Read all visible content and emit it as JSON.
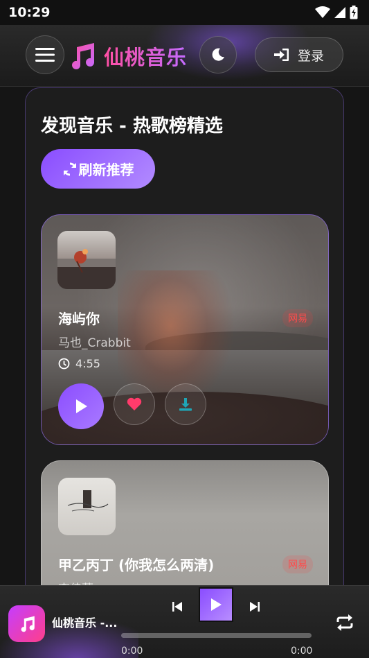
{
  "status_bar": {
    "time": "10:29"
  },
  "header": {
    "app_name": "仙桃音乐",
    "login_label": "登录",
    "icons": {
      "menu": "hamburger-menu-icon",
      "logo": "music-note-icon",
      "theme": "moon-icon",
      "login": "sign-in-icon"
    }
  },
  "main": {
    "title": "发现音乐 - 热歌榜精选",
    "refresh_label": "刷新推荐",
    "songs": [
      {
        "title": "海屿你",
        "artist": "马也_Crabbit",
        "duration": "4:55",
        "tag": "网易"
      },
      {
        "title": "甲乙丙丁 (你我怎么两清)",
        "artist": "李佳薇",
        "tag": "网易"
      }
    ]
  },
  "player": {
    "now_playing": "仙桃音乐 -...",
    "current_time": "0:00",
    "total_time": "0:00",
    "progress": 0,
    "icons": {
      "prev": "skip-previous-icon",
      "play": "play-icon",
      "next": "skip-next-icon",
      "repeat": "repeat-icon"
    }
  },
  "colors": {
    "accent": "#8a4dff",
    "brand_gradient_start": "#ff4fa3",
    "brand_gradient_end": "#c46bff",
    "tag_red": "#ff4b4b"
  }
}
